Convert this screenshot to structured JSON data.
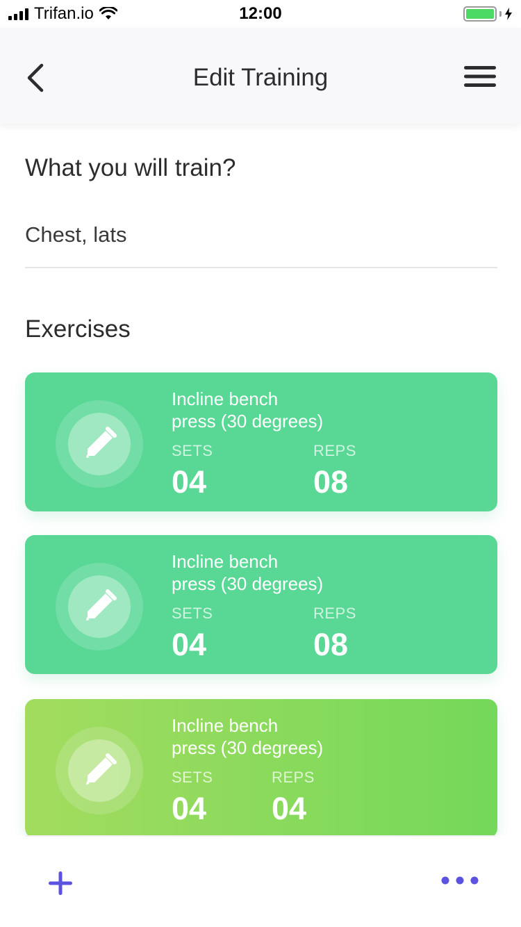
{
  "status_bar": {
    "carrier": "Trifan.io",
    "time": "12:00",
    "signal_icon": "signal-icon",
    "wifi_icon": "wifi-icon",
    "battery_icon": "battery-icon",
    "battery_level": 1.0,
    "charging_icon": "charging-bolt-icon"
  },
  "navbar": {
    "title": "Edit Training",
    "back_icon": "chevron-left-icon",
    "menu_icon": "hamburger-menu-icon"
  },
  "form": {
    "question": "What you will train?",
    "train_value": "Chest, lats"
  },
  "exercises": {
    "title": "Exercises",
    "items": [
      {
        "name_line1": "Incline bench",
        "name_line2": "press (30 degrees)",
        "sets_label": "SETS",
        "sets": "04",
        "reps_label": "REPS",
        "reps": "08",
        "icon": "pencil-icon",
        "color": "#58d795"
      },
      {
        "name_line1": "Incline bench",
        "name_line2": "press (30 degrees)",
        "sets_label": "SETS",
        "sets": "04",
        "reps_label": "REPS",
        "reps": "08",
        "icon": "pencil-icon",
        "color": "#58d795"
      },
      {
        "name_line1": "Incline bench",
        "name_line2": "press (30 degrees)",
        "sets_label": "SETS",
        "sets": "04",
        "reps_label": "REPS",
        "reps": "04",
        "icon": "pencil-icon",
        "color": "#8fdc5c"
      }
    ]
  },
  "toolbar": {
    "add_icon": "plus-icon",
    "more_icon": "more-dots-icon",
    "accent": "#5b52e0"
  }
}
